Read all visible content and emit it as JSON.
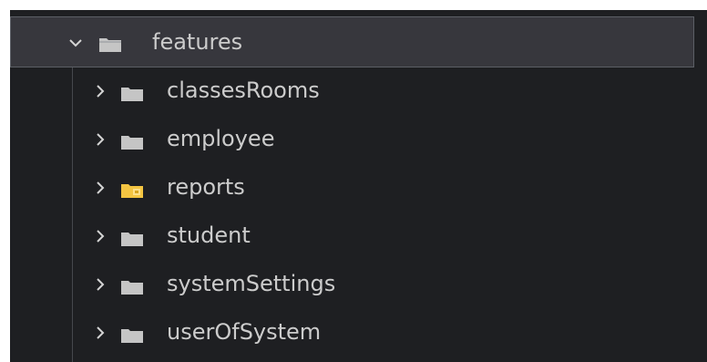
{
  "tree": {
    "root": {
      "label": "features",
      "expanded": true,
      "icon": "open-folder-icon"
    },
    "children": [
      {
        "label": "classesRooms",
        "icon": "folder-icon",
        "expanded": false,
        "color": "#c5c5c5"
      },
      {
        "label": "employee",
        "icon": "folder-icon",
        "expanded": false,
        "color": "#c5c5c5"
      },
      {
        "label": "reports",
        "icon": "reports-folder-icon",
        "expanded": false,
        "color": "#f4c542"
      },
      {
        "label": "student",
        "icon": "folder-icon",
        "expanded": false,
        "color": "#c5c5c5"
      },
      {
        "label": "systemSettings",
        "icon": "folder-icon",
        "expanded": false,
        "color": "#c5c5c5"
      },
      {
        "label": "userOfSystem",
        "icon": "folder-icon",
        "expanded": false,
        "color": "#c5c5c5"
      }
    ]
  },
  "colors": {
    "background": "#1e1f22",
    "selection": "#37373d",
    "selection_border": "#5c5f66",
    "text": "#cccccc",
    "tree_guide": "#46484d"
  }
}
